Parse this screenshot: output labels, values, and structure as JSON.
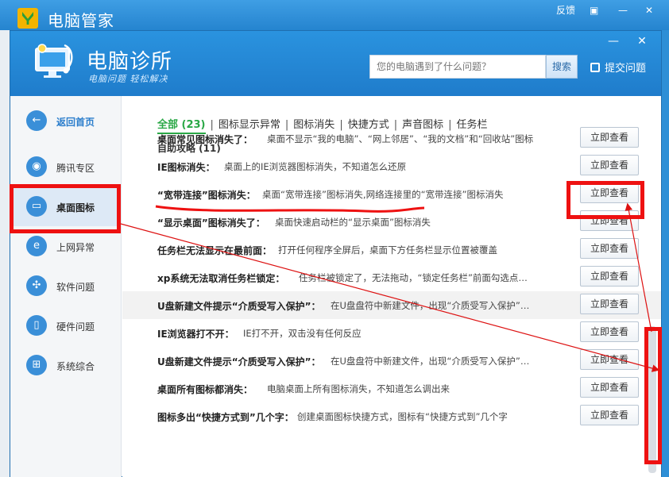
{
  "outer_window": {
    "title": "电脑管家",
    "feedback": "反馈"
  },
  "app": {
    "title": "电脑诊所",
    "subtitle": "电脑问题 轻松解决"
  },
  "search": {
    "placeholder": "您的电脑遇到了什么问题？",
    "button": "搜索"
  },
  "header": {
    "submit_label": "提交问题"
  },
  "sidebar": {
    "back": "返回首页",
    "items": [
      {
        "label": "腾讯专区",
        "icon": "penguin-icon"
      },
      {
        "label": "桌面图标",
        "icon": "monitor-icon",
        "active": true
      },
      {
        "label": "上网异常",
        "icon": "ie-icon"
      },
      {
        "label": "软件问题",
        "icon": "software-icon"
      },
      {
        "label": "硬件问题",
        "icon": "hardware-icon"
      },
      {
        "label": "系统综合",
        "icon": "windows-icon"
      }
    ]
  },
  "tabs": [
    {
      "label": "全部 (23)",
      "active": true
    },
    {
      "label": "图标显示异常"
    },
    {
      "label": "图标消失"
    },
    {
      "label": "快捷方式"
    },
    {
      "label": "声音图标"
    },
    {
      "label": "任务栏"
    }
  ],
  "section_title": "自助攻略 (11)",
  "button_label": "立即查看",
  "rows": [
    {
      "title": "桌面常见图标消失了：",
      "desc": "桌面不显示“我的电脑”、“网上邻居”、“我的文档”和“回收站”图标"
    },
    {
      "title": "IE图标消失：",
      "desc": "桌面上的IE浏览器图标消失，不知道怎么还原"
    },
    {
      "title": "“宽带连接”图标消失：",
      "desc": "桌面“宽带连接”图标消失,网络连接里的“宽带连接”图标消失"
    },
    {
      "title": "“显示桌面”图标消失了：",
      "desc": "桌面快速启动栏的“显示桌面”图标消失"
    },
    {
      "title": "任务栏无法显示在最前面：",
      "desc": "打开任何程序全屏后，桌面下方任务栏显示位置被覆盖"
    },
    {
      "title": "xp系统无法取消任务栏锁定：",
      "desc": "任务栏被锁定了，无法拖动，“锁定任务栏”前面勾选点…"
    },
    {
      "title": "U盘新建文件提示“介质受写入保护”：",
      "desc": "在U盘盘符中新建文件，出现“介质受写入保护”…"
    },
    {
      "title": "IE浏览器打不开：",
      "desc": "IE打不开，双击没有任何反应"
    },
    {
      "title": "U盘新建文件提示“介质受写入保护”：",
      "desc": "在U盘盘符中新建文件，出现“介质受写入保护”…"
    },
    {
      "title": "桌面所有图标都消失：",
      "desc": "电脑桌面上所有图标消失，不知道怎么调出来"
    },
    {
      "title": "图标多出“快捷方式到”几个字：",
      "desc": "创建桌面图标快捷方式，图标有“快捷方式到”几个字"
    }
  ],
  "colors": {
    "accent": "#2584cf",
    "tab_active": "#2aa846",
    "annotation": "#e11111"
  }
}
